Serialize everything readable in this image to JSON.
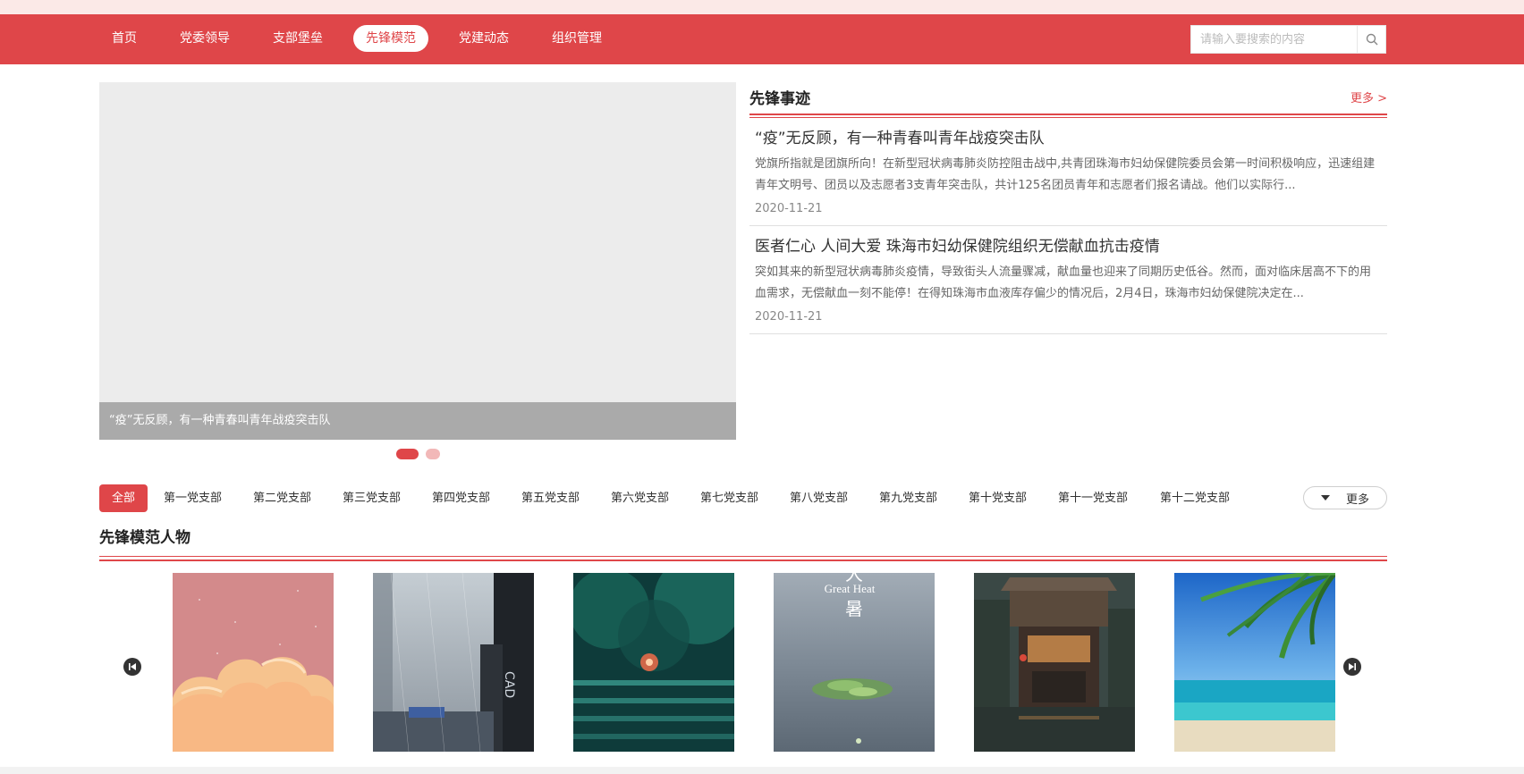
{
  "nav": {
    "items": [
      {
        "label": "首页",
        "active": false
      },
      {
        "label": "党委领导",
        "active": false
      },
      {
        "label": "支部堡垒",
        "active": false
      },
      {
        "label": "先锋模范",
        "active": true
      },
      {
        "label": "党建动态",
        "active": false
      },
      {
        "label": "组织管理",
        "active": false
      }
    ],
    "accent": "#df4649"
  },
  "search": {
    "placeholder": "请输入要搜索的内容",
    "value": "",
    "icon": "search-icon"
  },
  "banner": {
    "caption": "“疫”无反顾，有一种青春叫青年战疫突击队",
    "slides": 2,
    "active_slide": 1
  },
  "news": {
    "title": "先锋事迹",
    "more": "更多 >",
    "items": [
      {
        "title": "“疫”无反顾，有一种青春叫青年战疫突击队",
        "desc": "党旗所指就是团旗所向！在新型冠状病毒肺炎防控阻击战中,共青团珠海市妇幼保健院委员会第一时间积极响应，迅速组建青年文明号、团员以及志愿者3支青年突击队，共计125名团员青年和志愿者们报名请战。他们以实际行...",
        "date": "2020-11-21"
      },
      {
        "title": "医者仁心 人间大爱 珠海市妇幼保健院组织无偿献血抗击疫情",
        "desc": "突如其来的新型冠状病毒肺炎疫情，导致街头人流量骤减，献血量也迎来了同期历史低谷。然而，面对临床居高不下的用血需求，无偿献血一刻不能停！在得知珠海市血液库存偏少的情况后，2月4日，珠海市妇幼保健院决定在...",
        "date": "2020-11-21"
      }
    ]
  },
  "branches": {
    "items": [
      "全部",
      "第一党支部",
      "第二党支部",
      "第三党支部",
      "第四党支部",
      "第五党支部",
      "第六党支部",
      "第七党支部",
      "第八党支部",
      "第九党支部",
      "第十党支部",
      "第十一党支部",
      "第十二党支部"
    ],
    "active_index": 0,
    "more": "更多"
  },
  "people": {
    "title": "先锋模范人物",
    "cards": [
      {
        "name": "pink-clouds-image"
      },
      {
        "name": "rainy-city-image"
      },
      {
        "name": "forest-steps-image"
      },
      {
        "name": "great-heat-lotus-image",
        "text_en": "Great Heat",
        "text_zh": "暑",
        "text_zh_top": "大"
      },
      {
        "name": "rainy-street-house-image"
      },
      {
        "name": "palm-beach-image"
      }
    ]
  }
}
